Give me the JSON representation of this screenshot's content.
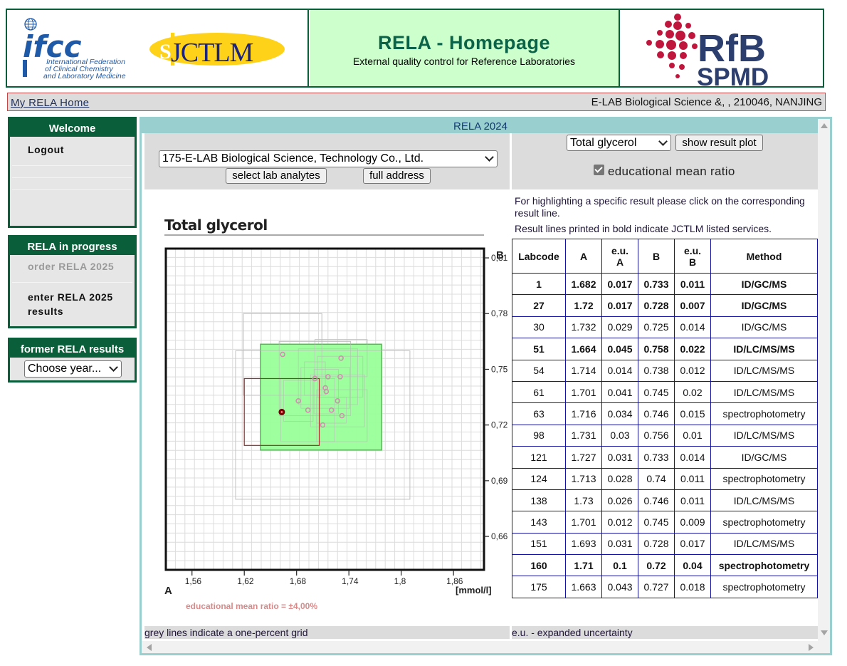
{
  "header": {
    "ifcc_logo": "ifcc",
    "ifcc_text": [
      "International Federation",
      "of Clinical Chemistry",
      "and Laboratory Medicine"
    ],
    "jctlm_logo": "JCTLM",
    "title": "RELA - Homepage",
    "subtitle": "External quality control for Reference Laboratories",
    "rfb_logo": [
      "RfB",
      "SPMD"
    ]
  },
  "infobar": {
    "home_link": "My RELA Home",
    "lab": "E-LAB Biological Science &, , 210046, NANJING"
  },
  "sidebar": {
    "welcome": {
      "title": "Welcome",
      "logout": "Logout"
    },
    "progress": {
      "title": "RELA in progress",
      "order": "order RELA 2025",
      "enter": "enter RELA 2025 results"
    },
    "former": {
      "title": "former RELA results",
      "select": "Choose year..."
    }
  },
  "main": {
    "title": "RELA 2024",
    "lab_select": "175-E-LAB Biological Science, Technology Co., Ltd.",
    "btn_analytes": "select lab analytes",
    "btn_address": "full address",
    "analyte_select": "Total glycerol",
    "btn_plot": "show result plot",
    "checkbox_label": "educational mean ratio",
    "checkbox_checked": true,
    "note1": "For highlighting a specific result please click on the corresponding result line.",
    "note2": "Result lines printed in bold indicate JCTLM listed services.",
    "footer_left": "grey lines indicate a one-percent grid",
    "footer_right": "e.u. - expanded uncertainty"
  },
  "table": {
    "headers": [
      "Labcode",
      "A",
      "e.u. A",
      "B",
      "e.u. B",
      "Method"
    ],
    "rows": [
      {
        "labcode": "1",
        "a": "1.682",
        "eua": "0.017",
        "b": "0.733",
        "eub": "0.011",
        "method": "ID/GC/MS",
        "bold": true
      },
      {
        "labcode": "27",
        "a": "1.72",
        "eua": "0.017",
        "b": "0.728",
        "eub": "0.007",
        "method": "ID/GC/MS",
        "bold": true
      },
      {
        "labcode": "30",
        "a": "1.732",
        "eua": "0.029",
        "b": "0.725",
        "eub": "0.014",
        "method": "ID/GC/MS",
        "bold": false
      },
      {
        "labcode": "51",
        "a": "1.664",
        "eua": "0.045",
        "b": "0.758",
        "eub": "0.022",
        "method": "ID/LC/MS/MS",
        "bold": true
      },
      {
        "labcode": "54",
        "a": "1.714",
        "eua": "0.014",
        "b": "0.738",
        "eub": "0.012",
        "method": "ID/LC/MS/MS",
        "bold": false
      },
      {
        "labcode": "61",
        "a": "1.701",
        "eua": "0.041",
        "b": "0.745",
        "eub": "0.02",
        "method": "ID/LC/MS/MS",
        "bold": false
      },
      {
        "labcode": "63",
        "a": "1.716",
        "eua": "0.034",
        "b": "0.746",
        "eub": "0.015",
        "method": "spectrophotometry",
        "bold": false
      },
      {
        "labcode": "98",
        "a": "1.731",
        "eua": "0.03",
        "b": "0.756",
        "eub": "0.01",
        "method": "ID/LC/MS/MS",
        "bold": false
      },
      {
        "labcode": "121",
        "a": "1.727",
        "eua": "0.031",
        "b": "0.733",
        "eub": "0.014",
        "method": "ID/GC/MS",
        "bold": false
      },
      {
        "labcode": "124",
        "a": "1.713",
        "eua": "0.028",
        "b": "0.74",
        "eub": "0.011",
        "method": "spectrophotometry",
        "bold": false
      },
      {
        "labcode": "138",
        "a": "1.73",
        "eua": "0.026",
        "b": "0.746",
        "eub": "0.011",
        "method": "ID/LC/MS/MS",
        "bold": false
      },
      {
        "labcode": "143",
        "a": "1.701",
        "eua": "0.012",
        "b": "0.745",
        "eub": "0.009",
        "method": "spectrophotometry",
        "bold": false
      },
      {
        "labcode": "151",
        "a": "1.693",
        "eua": "0.031",
        "b": "0.728",
        "eub": "0.017",
        "method": "ID/LC/MS/MS",
        "bold": false
      },
      {
        "labcode": "160",
        "a": "1.71",
        "eua": "0.1",
        "b": "0.72",
        "eub": "0.04",
        "method": "spectrophotometry",
        "bold": true
      },
      {
        "labcode": "175",
        "a": "1.663",
        "eua": "0.043",
        "b": "0.727",
        "eub": "0.018",
        "method": "spectrophotometry",
        "bold": false
      }
    ]
  },
  "chart_data": {
    "type": "scatter",
    "title": "Total glycerol",
    "xlabel": "A",
    "ylabel": "B",
    "unit": "[mmol/l]",
    "xlim": [
      1.53,
      1.895
    ],
    "ylim": [
      0.642,
      0.815
    ],
    "xticks": [
      1.56,
      1.62,
      1.68,
      1.74,
      1.8,
      1.86
    ],
    "xtick_labels": [
      "1,56",
      "1,62",
      "1,68",
      "1,74",
      "1,8",
      "1,86"
    ],
    "yticks": [
      0.66,
      0.69,
      0.72,
      0.75,
      0.78,
      0.81
    ],
    "ytick_labels": [
      "0,66",
      "0,69",
      "0,72",
      "0,75",
      "0,78",
      "0,81"
    ],
    "grid": "one-percent grid",
    "mean_box": {
      "x": [
        1.6385,
        1.7775
      ],
      "y": [
        0.7065,
        0.7635
      ],
      "color": "#99ff99"
    },
    "highlight": {
      "labcode": "175",
      "x": 1.663,
      "y": 0.727,
      "color": "#8b0000"
    },
    "annotation": "educational mean ratio = ±4,00%"
  }
}
